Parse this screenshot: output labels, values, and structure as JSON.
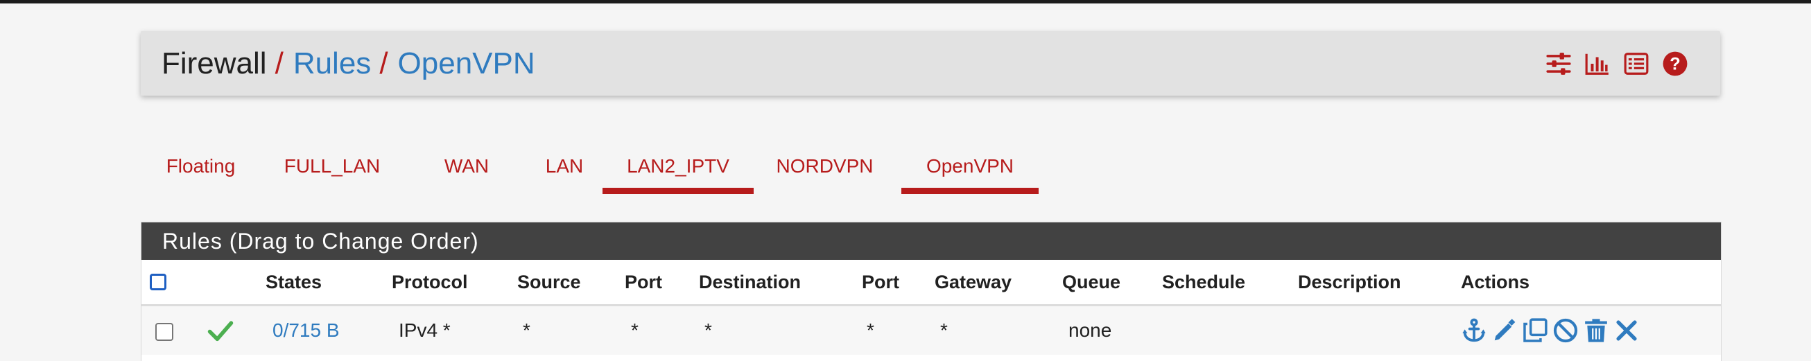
{
  "breadcrumb": {
    "root": "Firewall",
    "separator": "/",
    "items": [
      "Rules",
      "OpenVPN"
    ]
  },
  "header_icons": [
    "sliders-icon",
    "bar-chart-icon",
    "list-icon",
    "help-icon"
  ],
  "tabs": [
    {
      "label": "Floating",
      "active": false
    },
    {
      "label": "FULL_LAN",
      "active": false
    },
    {
      "label": "WAN",
      "active": false
    },
    {
      "label": "LAN",
      "active": false
    },
    {
      "label": "LAN2_IPTV",
      "active": true
    },
    {
      "label": "NORDVPN",
      "active": false
    },
    {
      "label": "OpenVPN",
      "active": true
    }
  ],
  "rules": {
    "title": "Rules (Drag to Change Order)",
    "columns": [
      "States",
      "Protocol",
      "Source",
      "Port",
      "Destination",
      "Port",
      "Gateway",
      "Queue",
      "Schedule",
      "Description",
      "Actions"
    ],
    "rows": [
      {
        "checked": false,
        "status": "pass",
        "states": "0/715 B",
        "protocol": "IPv4 *",
        "source": "*",
        "source_port": "*",
        "destination": "*",
        "destination_port": "*",
        "gateway": "*",
        "queue": "none",
        "schedule": "",
        "description": ""
      }
    ],
    "action_icons": [
      "anchor-icon",
      "edit-icon",
      "copy-icon",
      "disable-icon",
      "trash-icon",
      "delete-icon"
    ]
  },
  "colors": {
    "accent_red": "#b71c1c",
    "link_blue": "#2f7bbf",
    "pass_green": "#4caf50",
    "panel_header": "#424242"
  }
}
